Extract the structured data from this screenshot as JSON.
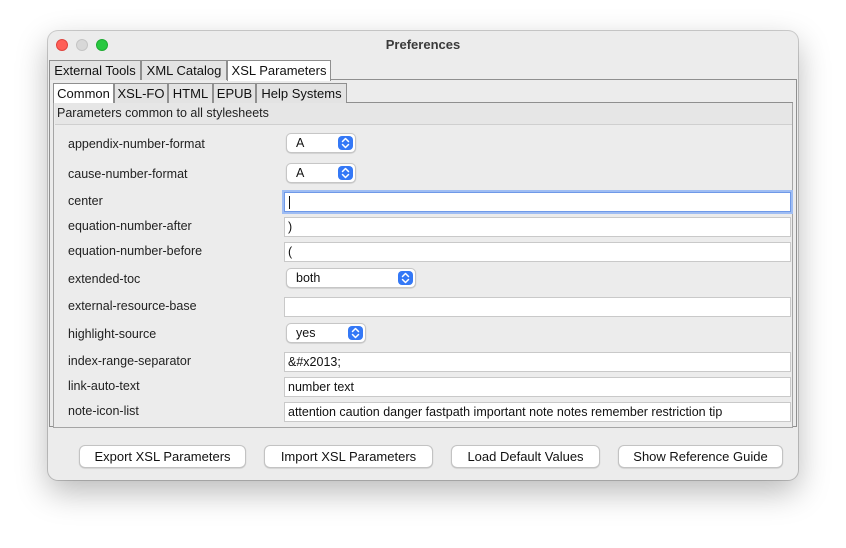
{
  "window": {
    "title": "Preferences"
  },
  "tabs_top": [
    {
      "label": "External Tools",
      "selected": false
    },
    {
      "label": "XML Catalog",
      "selected": false
    },
    {
      "label": "XSL Parameters",
      "selected": true
    }
  ],
  "tabs_sub": [
    {
      "label": "Common",
      "selected": true
    },
    {
      "label": "XSL-FO",
      "selected": false
    },
    {
      "label": "HTML",
      "selected": false
    },
    {
      "label": "EPUB",
      "selected": false
    },
    {
      "label": "Help Systems",
      "selected": false
    }
  ],
  "panel": {
    "header": "Parameters common to all stylesheets",
    "params": [
      {
        "label": "appendix-number-format",
        "type": "select",
        "value": "A"
      },
      {
        "label": "cause-number-format",
        "type": "select",
        "value": "A"
      },
      {
        "label": "center",
        "type": "text",
        "value": "",
        "focused": true
      },
      {
        "label": "equation-number-after",
        "type": "text",
        "value": ")"
      },
      {
        "label": "equation-number-before",
        "type": "text",
        "value": "("
      },
      {
        "label": "extended-toc",
        "type": "select",
        "value": "both"
      },
      {
        "label": "external-resource-base",
        "type": "text",
        "value": ""
      },
      {
        "label": "highlight-source",
        "type": "select",
        "value": "yes"
      },
      {
        "label": "index-range-separator",
        "type": "text",
        "value": "&#x2013;"
      },
      {
        "label": "link-auto-text",
        "type": "text",
        "value": "number text"
      },
      {
        "label": "note-icon-list",
        "type": "text",
        "value": "attention caution danger fastpath important note notes remember restriction tip"
      }
    ]
  },
  "buttons": {
    "export": "Export XSL Parameters",
    "import": "Import XSL Parameters",
    "load_defaults": "Load Default Values",
    "reference_guide": "Show Reference Guide"
  },
  "colors": {
    "accent": "#3478f6",
    "focus_ring": "#9fbdf3"
  }
}
